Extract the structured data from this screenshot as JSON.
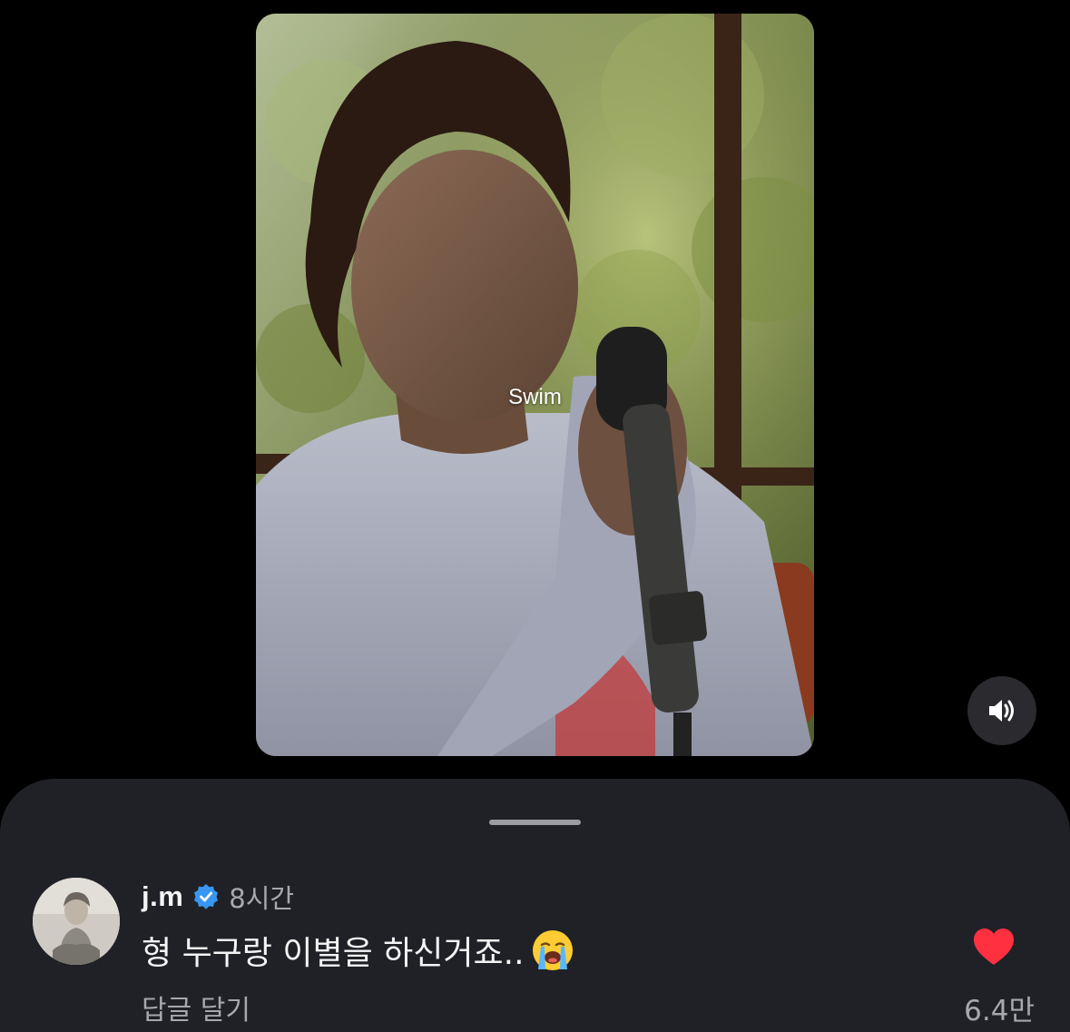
{
  "video": {
    "caption": "Swim",
    "sound_icon": "speaker-volume-icon"
  },
  "comment_sheet": {
    "comment": {
      "username": "j.m",
      "verified_icon": "verified-badge-icon",
      "time": "8시간",
      "text": "형 누구랑 이별을 하신거죠..",
      "emoji_icon": "loudly-crying-face-emoji-icon",
      "reply_label": "답글 달기",
      "like_icon": "heart-icon",
      "like_count": "6.4만",
      "liked": true
    }
  },
  "colors": {
    "background": "#000000",
    "sheet": "#1f2126",
    "heart": "#ff3040",
    "verified": "#3897f0",
    "secondary_text": "#a6a8ad"
  }
}
